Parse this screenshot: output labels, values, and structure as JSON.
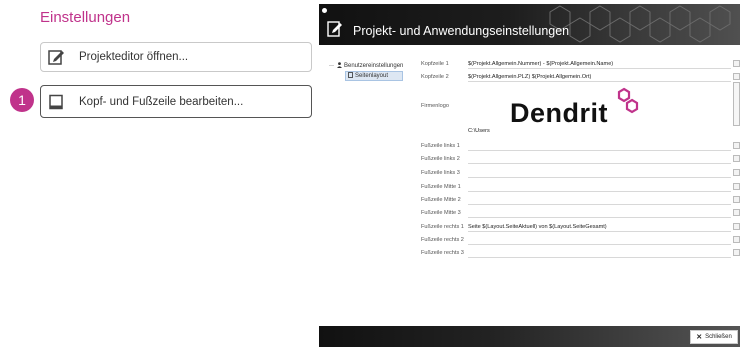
{
  "left": {
    "title": "Einstellungen",
    "buttons": [
      {
        "label": "Projekteditor öffnen...",
        "icon": "edit-icon"
      },
      {
        "label": "Kopf- und Fußzeile bearbeiten...",
        "icon": "page-layout-icon"
      }
    ],
    "step_badge": "1",
    "accent_color": "#c0338b"
  },
  "dialog": {
    "title": "Projekt- und Anwendungseinstellungen",
    "tree": {
      "root_label": "Benutzereinstellungen",
      "selected_label": "Seitenlayout"
    },
    "fields": [
      {
        "label": "Kopfzeile 1",
        "value": "$(Projekt.Allgemein.Nummer) - $(Projekt.Allgemein.Name)"
      },
      {
        "label": "Kopfzeile 2",
        "value": "$(Projekt.Allgemein.PLZ) $(Projekt.Allgemein.Ort)"
      },
      {
        "label": "Fußzeile links 1",
        "value": ""
      },
      {
        "label": "Fußzeile links 2",
        "value": ""
      },
      {
        "label": "Fußzeile links 3",
        "value": ""
      },
      {
        "label": "Fußzeile Mitte 1",
        "value": ""
      },
      {
        "label": "Fußzeile Mitte 2",
        "value": ""
      },
      {
        "label": "Fußzeile Mitte 3",
        "value": ""
      },
      {
        "label": "Fußzeile rechts 1",
        "value": "Seite $(Layout.SeiteAktuell) von $(Layout.SeiteGesamt)"
      },
      {
        "label": "Fußzeile rechts 2",
        "value": ""
      },
      {
        "label": "Fußzeile rechts 3",
        "value": ""
      }
    ],
    "logo": {
      "label": "Firmenlogo",
      "logo_text": "Dendrit",
      "path": "C:\\Users"
    },
    "close_label": "Schließen"
  }
}
